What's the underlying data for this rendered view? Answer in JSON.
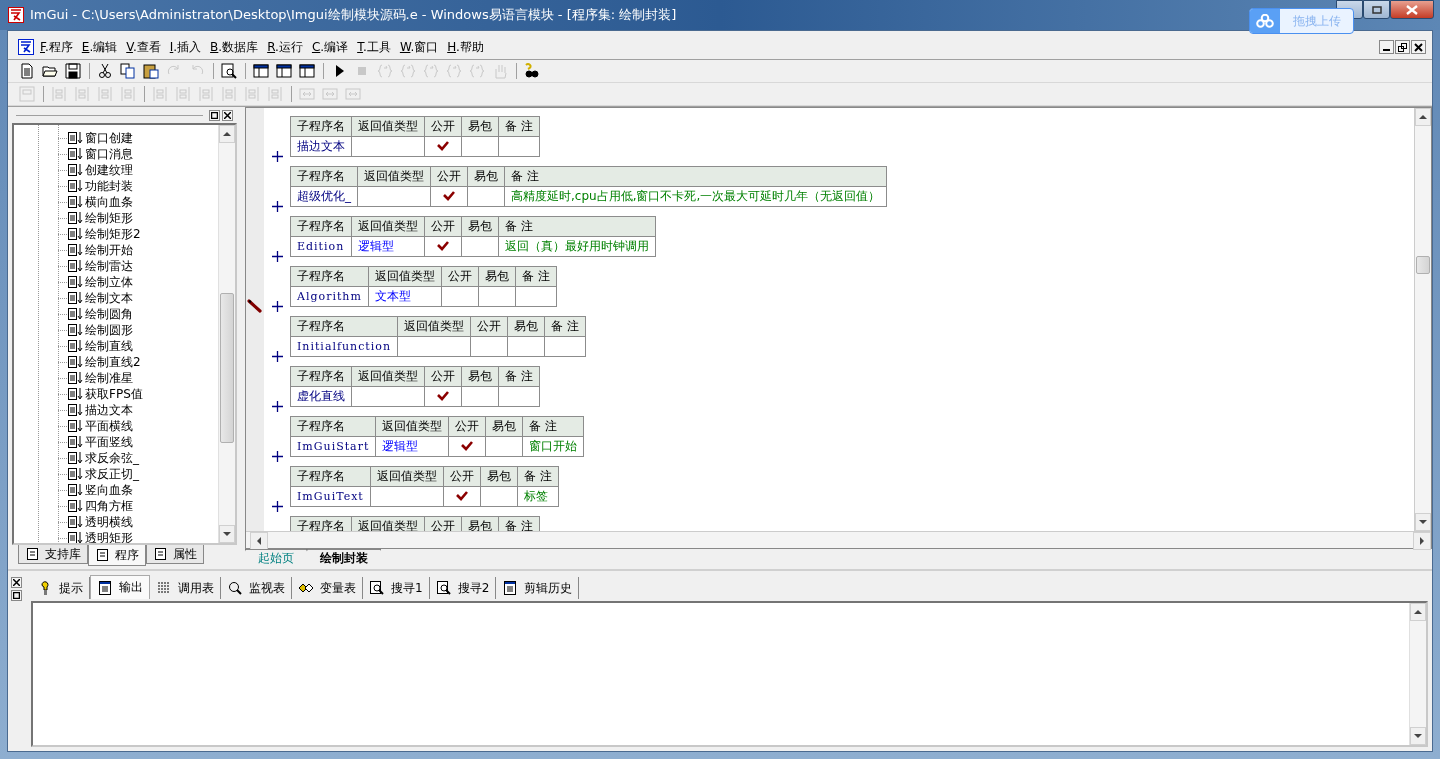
{
  "window": {
    "title": "ImGui - C:\\Users\\Administrator\\Desktop\\Imgui绘制模块源码.e - Windows易语言模块 - [程序集: 绘制封装]"
  },
  "upload_widget": {
    "label": "拖拽上传"
  },
  "menu": [
    {
      "key": "F",
      "label": ".程序"
    },
    {
      "key": "E",
      "label": ".编辑"
    },
    {
      "key": "V",
      "label": ".查看"
    },
    {
      "key": "I",
      "label": ".插入"
    },
    {
      "key": "B",
      "label": ".数据库"
    },
    {
      "key": "R",
      "label": ".运行"
    },
    {
      "key": "C",
      "label": ".编译"
    },
    {
      "key": "T",
      "label": ".工具"
    },
    {
      "key": "W",
      "label": ".窗口"
    },
    {
      "key": "H",
      "label": ".帮助"
    }
  ],
  "toolbar_1": [
    {
      "kind": "new",
      "disabled": false
    },
    {
      "kind": "open",
      "disabled": false
    },
    {
      "kind": "save",
      "disabled": false
    },
    {
      "kind": "sep"
    },
    {
      "kind": "cut",
      "disabled": false
    },
    {
      "kind": "copy",
      "disabled": false
    },
    {
      "kind": "paste",
      "disabled": false
    },
    {
      "kind": "redo",
      "disabled": true
    },
    {
      "kind": "undo",
      "disabled": true
    },
    {
      "kind": "sep"
    },
    {
      "kind": "find",
      "disabled": false
    },
    {
      "kind": "sep"
    },
    {
      "kind": "layout",
      "disabled": false
    },
    {
      "kind": "layout",
      "disabled": false
    },
    {
      "kind": "layout",
      "disabled": false
    },
    {
      "kind": "sep"
    },
    {
      "kind": "run",
      "disabled": false
    },
    {
      "kind": "stop",
      "disabled": true
    },
    {
      "kind": "step",
      "disabled": true
    },
    {
      "kind": "step",
      "disabled": true
    },
    {
      "kind": "step",
      "disabled": true
    },
    {
      "kind": "step",
      "disabled": true
    },
    {
      "kind": "step",
      "disabled": true
    },
    {
      "kind": "hand",
      "disabled": true
    },
    {
      "kind": "sep"
    },
    {
      "kind": "help",
      "disabled": false
    }
  ],
  "toolbar_2": [
    {
      "kind": "form",
      "disabled": true
    },
    {
      "kind": "sep"
    },
    {
      "kind": "align",
      "disabled": true
    },
    {
      "kind": "align",
      "disabled": true
    },
    {
      "kind": "align",
      "disabled": true
    },
    {
      "kind": "align",
      "disabled": true
    },
    {
      "kind": "sep"
    },
    {
      "kind": "align",
      "disabled": true
    },
    {
      "kind": "align",
      "disabled": true
    },
    {
      "kind": "align",
      "disabled": true
    },
    {
      "kind": "align",
      "disabled": true
    },
    {
      "kind": "align",
      "disabled": true
    },
    {
      "kind": "align",
      "disabled": true
    },
    {
      "kind": "sep"
    },
    {
      "kind": "size",
      "disabled": true
    },
    {
      "kind": "size",
      "disabled": true
    },
    {
      "kind": "size",
      "disabled": true
    }
  ],
  "tree_items": [
    "窗口创建",
    "窗口消息",
    "创建纹理",
    "功能封装",
    "横向血条",
    "绘制矩形",
    "绘制矩形2",
    "绘制开始",
    "绘制雷达",
    "绘制立体",
    "绘制文本",
    "绘制圆角",
    "绘制圆形",
    "绘制直线",
    "绘制直线2",
    "绘制准星",
    "获取FPS值",
    "描边文本",
    "平面横线",
    "平面竖线",
    "求反余弦_",
    "求反正切_",
    "竖向血条",
    "四角方框",
    "透明横线",
    "透明矩形"
  ],
  "left_tabs": [
    {
      "label": "支持库",
      "selected": false
    },
    {
      "label": "程序",
      "selected": true
    },
    {
      "label": "属性",
      "selected": false
    }
  ],
  "tables": [
    {
      "columns": [
        "子程序名",
        "返回值类型",
        "公开",
        "易包",
        "备 注"
      ],
      "expanded": false,
      "current": false,
      "name": "描边文本",
      "public": true
    },
    {
      "columns": [
        "子程序名",
        "返回值类型",
        "公开",
        "易包",
        "备 注"
      ],
      "expanded": false,
      "current": false,
      "name": "超级优化_",
      "public": true,
      "note": "高精度延时,cpu占用低,窗口不卡死,一次最大可延时几年（无返回值）"
    },
    {
      "columns": [
        "子程序名",
        "返回值类型",
        "公开",
        "易包",
        "备 注"
      ],
      "expanded": false,
      "current": false,
      "name": "Edition",
      "return_type": "逻辑型",
      "public": true,
      "note": "返回（真）最好用时钟调用"
    },
    {
      "columns": [
        "子程序名",
        "返回值类型",
        "公开",
        "易包",
        "备 注"
      ],
      "expanded": false,
      "current": true,
      "name": "Algorithm",
      "return_type": "文本型",
      "public": false
    },
    {
      "columns": [
        "子程序名",
        "返回值类型",
        "公开",
        "易包",
        "备 注"
      ],
      "expanded": false,
      "current": false,
      "name": "Initialfunction",
      "public": false
    },
    {
      "columns": [
        "子程序名",
        "返回值类型",
        "公开",
        "易包",
        "备 注"
      ],
      "expanded": false,
      "current": false,
      "name": "虚化直线",
      "public": true
    },
    {
      "columns": [
        "子程序名",
        "返回值类型",
        "公开",
        "易包",
        "备 注"
      ],
      "expanded": false,
      "current": false,
      "name": "ImGuiStart",
      "return_type": "逻辑型",
      "public": true,
      "note": "窗口开始"
    },
    {
      "columns": [
        "子程序名",
        "返回值类型",
        "公开",
        "易包",
        "备 注"
      ],
      "expanded": false,
      "current": false,
      "name": "ImGuiText",
      "public": true,
      "note": "标签"
    },
    {
      "columns": [
        "子程序名",
        "返回值类型",
        "公开",
        "易包",
        "备 注"
      ],
      "current": false
    }
  ],
  "editor_tabs": [
    {
      "label": "起始页",
      "selected": false
    },
    {
      "label": "绘制封装",
      "selected": true
    }
  ],
  "bottom_tabs": [
    {
      "kind": "hint",
      "label": "提示",
      "selected": false
    },
    {
      "kind": "output",
      "label": "输出",
      "selected": true
    },
    {
      "kind": "calls",
      "label": "调用表",
      "selected": false
    },
    {
      "kind": "watch",
      "label": "监视表",
      "selected": false
    },
    {
      "kind": "vars",
      "label": "变量表",
      "selected": false
    },
    {
      "kind": "find",
      "label": "搜寻1",
      "selected": false
    },
    {
      "kind": "find",
      "label": "搜寻2",
      "selected": false
    },
    {
      "kind": "clip",
      "label": "剪辑历史",
      "selected": false
    }
  ]
}
